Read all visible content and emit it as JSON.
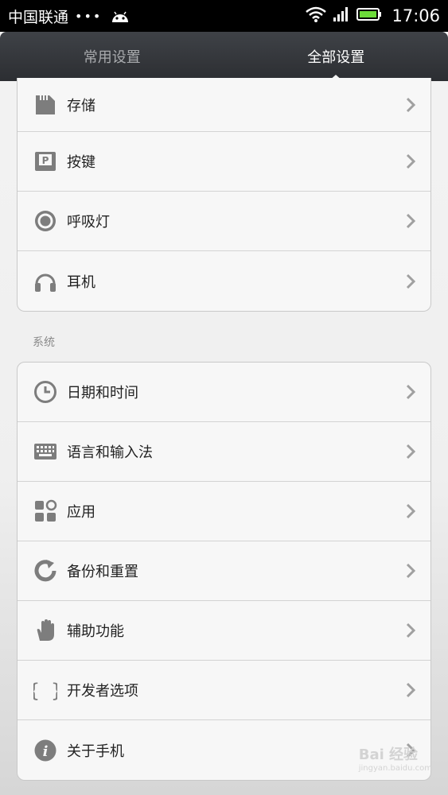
{
  "status_bar": {
    "carrier": "中国联通",
    "dots": "•••",
    "time": "17:06"
  },
  "tabs": [
    {
      "label": "常用设置",
      "active": false
    },
    {
      "label": "全部设置",
      "active": true
    }
  ],
  "group1": {
    "items": [
      {
        "label": "存储",
        "icon": "sd-card-icon"
      },
      {
        "label": "按键",
        "icon": "key-p-icon"
      },
      {
        "label": "呼吸灯",
        "icon": "led-icon"
      },
      {
        "label": "耳机",
        "icon": "headphones-icon"
      }
    ]
  },
  "section_system": "系统",
  "group2": {
    "items": [
      {
        "label": "日期和时间",
        "icon": "clock-icon"
      },
      {
        "label": "语言和输入法",
        "icon": "keyboard-icon"
      },
      {
        "label": "应用",
        "icon": "apps-icon"
      },
      {
        "label": "备份和重置",
        "icon": "backup-icon"
      },
      {
        "label": "辅助功能",
        "icon": "hand-icon"
      },
      {
        "label": "开发者选项",
        "icon": "braces-icon"
      },
      {
        "label": "关于手机",
        "icon": "info-icon"
      }
    ]
  },
  "watermark": {
    "text": "Bai 经验",
    "sub": "jingyan.baidu.com"
  },
  "colors": {
    "icon": "#7d7d7d",
    "tabbar": "#35373b",
    "chevron": "#a0a0a0"
  }
}
